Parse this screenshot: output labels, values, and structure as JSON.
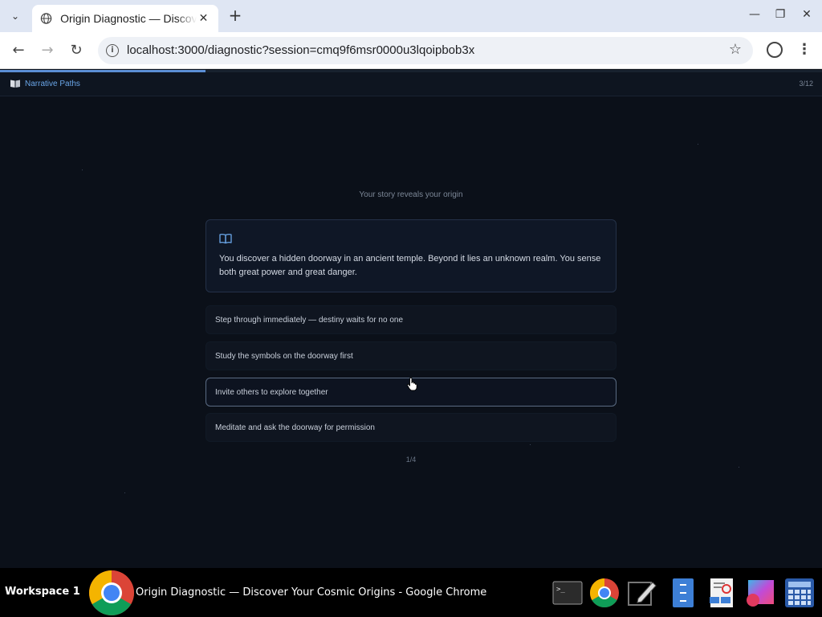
{
  "browser": {
    "tab_title": "Origin Diagnostic — Discover Your Cosmic Origins",
    "url": "localhost:3000/diagnostic?session=cmq9f6msr0000u3lqoipbob3x",
    "close_tab_glyph": "✕",
    "new_tab_glyph": "+",
    "minimize_glyph": "—",
    "restore_glyph": "❐",
    "close_window_glyph": "✕",
    "back_glyph": "←",
    "forward_glyph": "→",
    "reload_glyph": "↻",
    "star_glyph": "☆",
    "menu_glyph": "⋮",
    "info_glyph": "i",
    "tab_menu_glyph": "⌄"
  },
  "page": {
    "brand_label": "Narrative Paths",
    "counter": "3/12",
    "progress_fraction": 0.25,
    "subtitle": "Your story reveals your origin",
    "story_text": "You discover a hidden doorway in an ancient temple. Beyond it lies an unknown realm. You sense both great power and great danger.",
    "options": [
      {
        "label": "Step through immediately — destiny waits for no one"
      },
      {
        "label": "Study the symbols on the doorway first"
      },
      {
        "label": "Invite others to explore together"
      },
      {
        "label": "Meditate and ask the doorway for permission"
      }
    ],
    "hovered_option_index": 2,
    "pager": "1/4"
  },
  "colors": {
    "accent": "#6aa6e8",
    "background": "#0b1019",
    "card": "#0f1726"
  },
  "taskbar": {
    "workspace": "Workspace 1",
    "window_title": "Origin Diagnostic — Discover Your Cosmic Origins - Google Chrome",
    "icons": [
      "terminal-icon",
      "chrome-icon",
      "text-editor-icon",
      "file-manager-icon",
      "document-viewer-icon",
      "image-viewer-icon",
      "calculator-icon"
    ]
  }
}
